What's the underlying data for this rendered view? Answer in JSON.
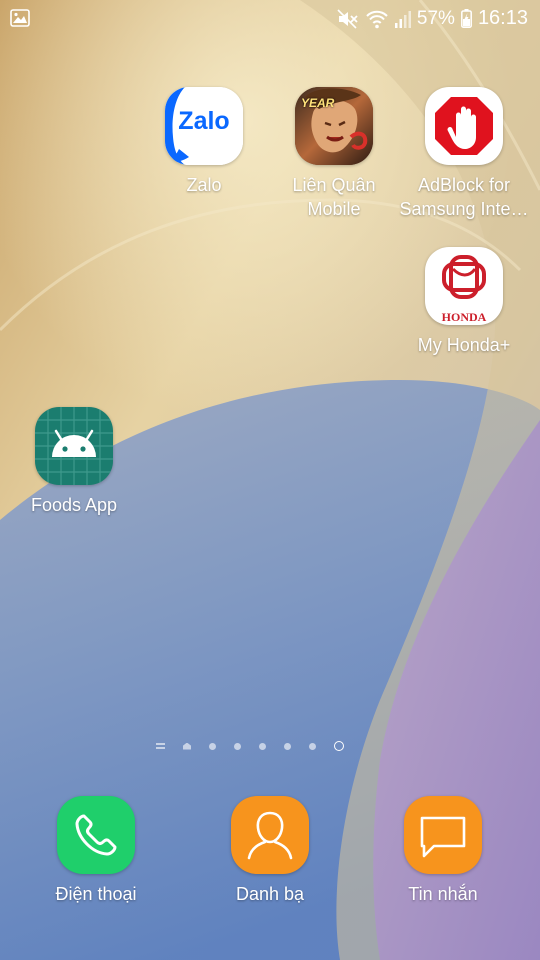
{
  "status_bar": {
    "battery": "57%",
    "time": "16:13"
  },
  "apps": [
    {
      "id": "zalo",
      "label": "Zalo",
      "icon_text": "Zalo"
    },
    {
      "id": "lien-quan",
      "label": "Liên Quân\nMobile",
      "icon_text": "YEAR"
    },
    {
      "id": "adblock",
      "label": "AdBlock for\nSamsung Inte…"
    },
    {
      "id": "myhonda",
      "label": "My Honda+",
      "icon_text": "HONDA"
    },
    {
      "id": "foods",
      "label": "Foods App"
    }
  ],
  "dock": [
    {
      "id": "phone",
      "label": "Điện thoại",
      "color": "#1fcf6b"
    },
    {
      "id": "contacts",
      "label": "Danh bạ",
      "color": "#f7941d"
    },
    {
      "id": "messages",
      "label": "Tin nhắn",
      "color": "#f7941d"
    }
  ],
  "colors": {
    "zalo_blue": "#0a68ff",
    "adblock_red": "#e0121e",
    "honda_red": "#cc1f2b",
    "android_green": "#1b7d6f"
  }
}
